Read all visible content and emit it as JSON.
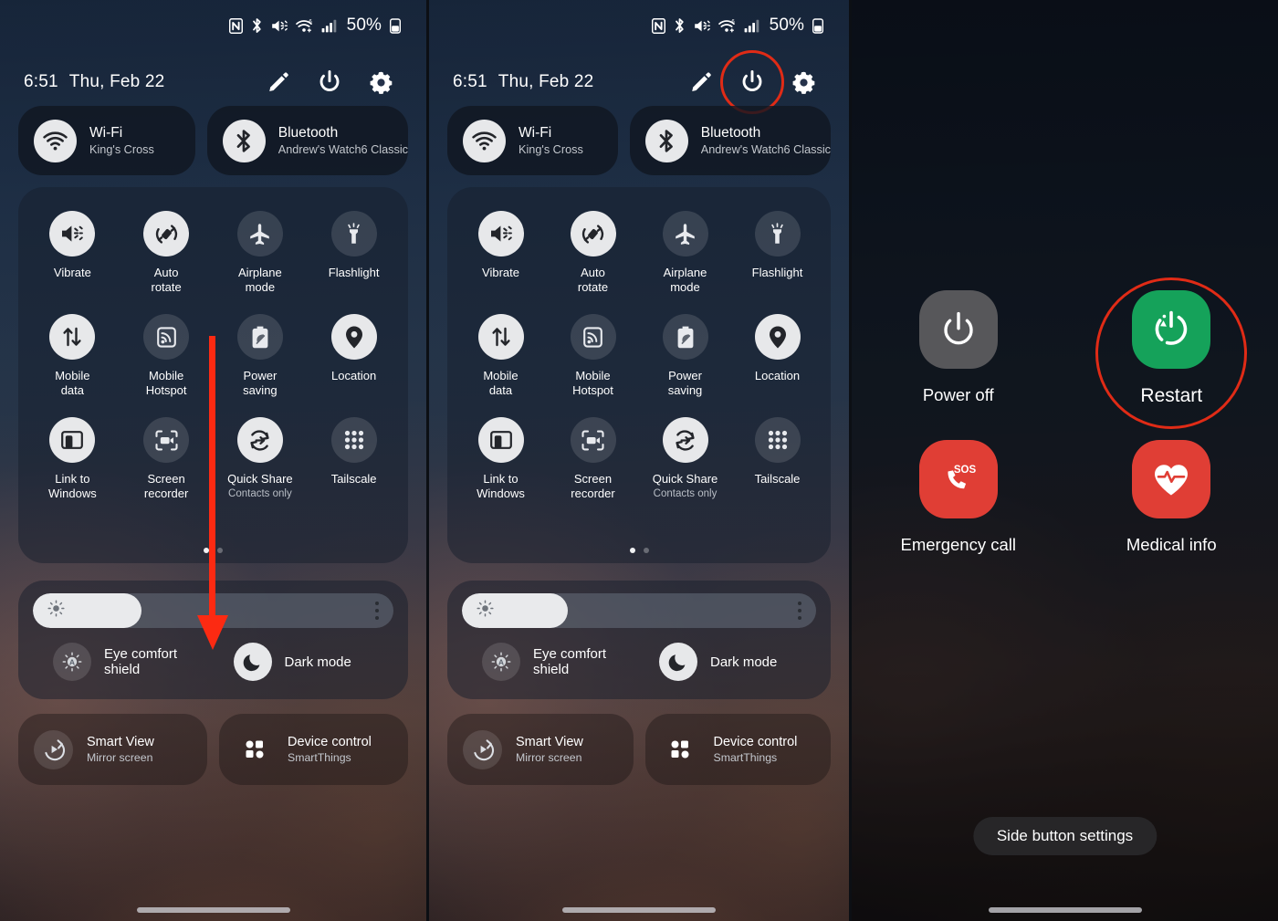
{
  "status_bar": {
    "icons": [
      "nfc-icon",
      "bluetooth-icon",
      "mute-icon",
      "wifi6-icon",
      "signal-icon"
    ],
    "battery_text": "50%"
  },
  "header": {
    "time": "6:51",
    "date": "Thu, Feb 22",
    "actions": [
      {
        "name": "edit-pencil-icon",
        "label": "Edit"
      },
      {
        "name": "power-icon",
        "label": "Power"
      },
      {
        "name": "gear-icon",
        "label": "Settings"
      }
    ]
  },
  "connectivity": [
    {
      "icon": "wifi-icon",
      "title": "Wi-Fi",
      "subtitle": "King's Cross",
      "state": "on"
    },
    {
      "icon": "bluetooth-icon",
      "title": "Bluetooth",
      "subtitle": "Andrew's Watch6 Classic",
      "state": "on"
    }
  ],
  "toggles": [
    {
      "icon": "vibrate-icon",
      "label": "Vibrate",
      "sub": "",
      "state": "on"
    },
    {
      "icon": "auto-rotate-icon",
      "label": "Auto\nrotate",
      "sub": "",
      "state": "on"
    },
    {
      "icon": "airplane-icon",
      "label": "Airplane\nmode",
      "sub": "",
      "state": "off"
    },
    {
      "icon": "flashlight-icon",
      "label": "Flashlight",
      "sub": "",
      "state": "off"
    },
    {
      "icon": "mobile-data-icon",
      "label": "Mobile\ndata",
      "sub": "",
      "state": "on"
    },
    {
      "icon": "hotspot-icon",
      "label": "Mobile\nHotspot",
      "sub": "",
      "state": "off"
    },
    {
      "icon": "power-saving-icon",
      "label": "Power\nsaving",
      "sub": "",
      "state": "off"
    },
    {
      "icon": "location-pin-icon",
      "label": "Location",
      "sub": "",
      "state": "on"
    },
    {
      "icon": "link-windows-icon",
      "label": "Link to\nWindows",
      "sub": "",
      "state": "on"
    },
    {
      "icon": "screen-recorder-icon",
      "label": "Screen\nrecorder",
      "sub": "",
      "state": "off"
    },
    {
      "icon": "quick-share-icon",
      "label": "Quick Share",
      "sub": "Contacts only",
      "state": "on"
    },
    {
      "icon": "tailscale-icon",
      "label": "Tailscale",
      "sub": "",
      "state": "off"
    }
  ],
  "page_dots": {
    "count": 2,
    "active_index": 0
  },
  "brightness": {
    "level_percent": 30,
    "sun_icon": "brightness-sun-icon",
    "menu_icon": "overflow-menu-icon"
  },
  "display_modes": [
    {
      "icon": "eye-comfort-icon",
      "label": "Eye comfort shield",
      "state": "off"
    },
    {
      "icon": "dark-mode-moon-icon",
      "label": "Dark mode",
      "state": "on"
    }
  ],
  "bottom_tiles": [
    {
      "icon": "smart-view-icon",
      "title": "Smart View",
      "subtitle": "Mirror screen"
    },
    {
      "icon": "device-control-icon",
      "title": "Device control",
      "subtitle": "SmartThings"
    }
  ],
  "power_menu": {
    "items": [
      {
        "icon": "power-off-icon",
        "label": "Power off",
        "color": "#57575a",
        "highlighted": false
      },
      {
        "icon": "restart-icon",
        "label": "Restart",
        "color": "#15a25a",
        "highlighted": true
      },
      {
        "icon": "emergency-sos-icon",
        "label": "Emergency call",
        "color": "#e03e35",
        "highlighted": false
      },
      {
        "icon": "medical-info-icon",
        "label": "Medical info",
        "color": "#e03e35",
        "highlighted": false
      }
    ],
    "side_button_settings": "Side button settings"
  },
  "annotations": {
    "arrow_color": "#fc2a12",
    "ring_color": "#e02b16"
  }
}
